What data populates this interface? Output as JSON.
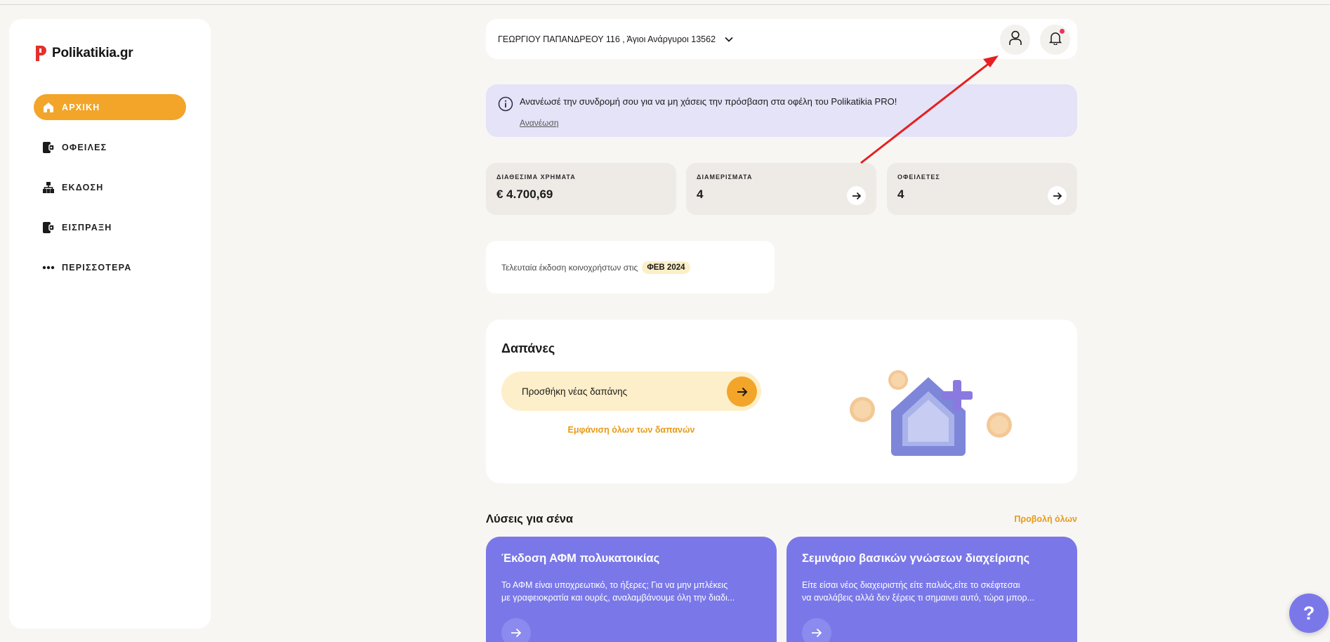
{
  "brand": {
    "name": "Polikatikia.gr",
    "accent": "#f2a528",
    "purple": "#7a78e8"
  },
  "sidebar": {
    "items": [
      {
        "label": "ΑΡΧΙΚΗ",
        "icon": "home-icon",
        "active": true
      },
      {
        "label": "ΟΦΕΙΛΕΣ",
        "icon": "wallet-icon",
        "active": false
      },
      {
        "label": "ΕΚΔΟΣΗ",
        "icon": "hierarchy-icon",
        "active": false
      },
      {
        "label": "ΕΙΣΠΡΑΞΗ",
        "icon": "wallet-icon",
        "active": false
      },
      {
        "label": "ΠΕΡΙΣΣΟΤΕΡΑ",
        "icon": "more-dots-icon",
        "active": false
      }
    ]
  },
  "header": {
    "address": "ΓΕΩΡΓΙΟΥ ΠΑΠΑΝΔΡΕΟΥ 116 , Άγιοι Ανάργυροι 13562",
    "notification_dot_color": "#e8345a"
  },
  "banner": {
    "text": "Ανανέωσέ την συνδρομή σου για να μη χάσεις την πρόσβαση στα οφέλη του Polikatikia PRO!",
    "link": "Ανανέωση"
  },
  "stats": {
    "funds": {
      "label": "ΔΙΑΘΕΣΙΜΑ ΧΡΗΜΑΤΑ",
      "value": "€ 4.700,69"
    },
    "apartments": {
      "label": "ΔΙΑΜΕΡΙΣΜΑΤΑ",
      "value": "4"
    },
    "debtors": {
      "label": "ΟΦΕΙΛΕΤΕΣ",
      "value": "4"
    }
  },
  "last_issue": {
    "text": "Τελευταία έκδοση κοινοχρήστων στις",
    "badge": "ΦΕΒ 2024"
  },
  "expenses": {
    "title": "Δαπάνες",
    "add_label": "Προσθήκη νέας δαπάνης",
    "show_all": "Εμφάνιση όλων των δαπανών"
  },
  "solutions": {
    "title": "Λύσεις για σένα",
    "view_all": "Προβολή όλων",
    "cards": [
      {
        "title": "Έκδοση ΑΦΜ πολυκατοικίας",
        "line1": "Το ΑΦΜ είναι υποχρεωτικό, το ήξερες; Για να μην μπλέκεις",
        "line2": "με γραφειοκρατία και ουρές, αναλαμβάνουμε όλη την διαδι..."
      },
      {
        "title": "Σεμινάριο βασικών γνώσεων διαχείρισης",
        "line1": "Είτε είσαι νέος διαχειριστής είτε παλιός,είτε το σκέφτεσαι",
        "line2": "να αναλάβεις αλλά δεν ξέρεις τι σημαινει αυτό, τώρα μπορ..."
      }
    ]
  },
  "help": {
    "label": "?"
  }
}
